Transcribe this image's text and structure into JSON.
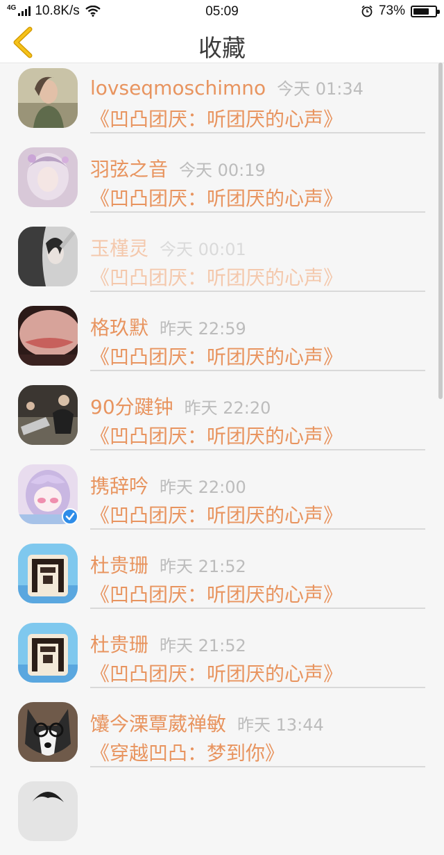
{
  "status_bar": {
    "network": "4G",
    "speed": "10.8K/s",
    "time": "05:09",
    "battery_percent": "73%",
    "battery_level": 0.73
  },
  "header": {
    "title": "收藏",
    "back_icon": "chevron-left-icon"
  },
  "colors": {
    "accent": "#e8945f",
    "back_icon": "#f0b400",
    "time_text": "#bcbcbc",
    "verified_badge": "#2e8ce8"
  },
  "favorites": [
    {
      "name": "lovseqmoschimno",
      "time": "今天 01:34",
      "title": "《凹凸团厌：听团厌的心声》",
      "avatar": "portrait-avatar"
    },
    {
      "name": "羽弦之音",
      "time": "今天 00:19",
      "title": "《凹凸团厌：听团厌的心声》",
      "avatar": "anime-girl-avatar"
    },
    {
      "name": "玉槿灵",
      "time": "今天 00:01",
      "title": "《凹凸团厌：听团厌的心声》",
      "avatar": "photo-avatar"
    },
    {
      "name": "格玖默",
      "time": "昨天 22:59",
      "title": "《凹凸团厌：听团厌的心声》",
      "avatar": "lips-avatar"
    },
    {
      "name": "90分踺钟",
      "time": "昨天 22:20",
      "title": "《凹凸团厌：听团厌的心声》",
      "avatar": "group-photo-avatar"
    },
    {
      "name": "携辞吟",
      "time": "昨天 22:00",
      "title": "《凹凸团厌：听团厌的心声》",
      "avatar": "anime-avatar"
    },
    {
      "name": "杜贵珊",
      "time": "昨天 21:52",
      "title": "《凹凸团厌：听团厌的心声》",
      "avatar": "character-avatar"
    },
    {
      "name": "杜贵珊",
      "time": "昨天 21:52",
      "title": "《凹凸团厌：听团厌的心声》",
      "avatar": "character-avatar"
    },
    {
      "name": "馕今溧覃葳禅敏",
      "time": "昨天 13:44",
      "title": "《穿越凹凸：梦到你》",
      "avatar": "dog-avatar"
    }
  ]
}
